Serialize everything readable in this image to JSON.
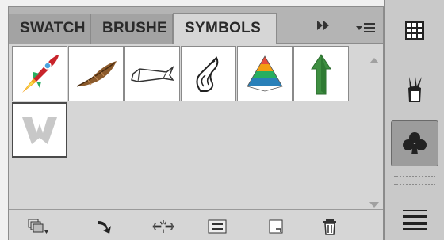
{
  "tabs": [
    {
      "label": "SWATCH",
      "active": false
    },
    {
      "label": "BRUSHE",
      "active": false
    },
    {
      "label": "SYMBOLS",
      "active": true
    }
  ],
  "tab_controls": {
    "expand_icon": "double-chevron-right-icon",
    "menu_icon": "panel-menu-icon"
  },
  "symbols": [
    {
      "name": "rocket",
      "icon": "rocket-icon"
    },
    {
      "name": "feather",
      "icon": "feather-icon"
    },
    {
      "name": "banner",
      "icon": "banner-icon"
    },
    {
      "name": "flourish",
      "icon": "flourish-icon"
    },
    {
      "name": "pyramid",
      "icon": "pyramid-icon"
    },
    {
      "name": "arrow",
      "icon": "green-arrow-icon"
    },
    {
      "name": "w-shape",
      "icon": "w-shape-icon",
      "selected": true
    }
  ],
  "bottom_toolbar": [
    "symbol-libraries-menu-icon",
    "place-symbol-instance-icon",
    "break-link-icon",
    "symbol-options-icon",
    "new-symbol-icon",
    "delete-symbol-icon"
  ],
  "dock": [
    {
      "icon": "swatches-grid-icon",
      "active": false
    },
    {
      "icon": "brushes-icon",
      "active": false
    },
    {
      "icon": "symbols-club-icon",
      "active": true
    },
    {
      "icon": "stroke-lines-icon",
      "active": false
    }
  ],
  "colors": {
    "panel_bg": "#d6d6d6",
    "tab_bar": "#b4b4b4",
    "dock_bg": "#c9c9c9"
  }
}
